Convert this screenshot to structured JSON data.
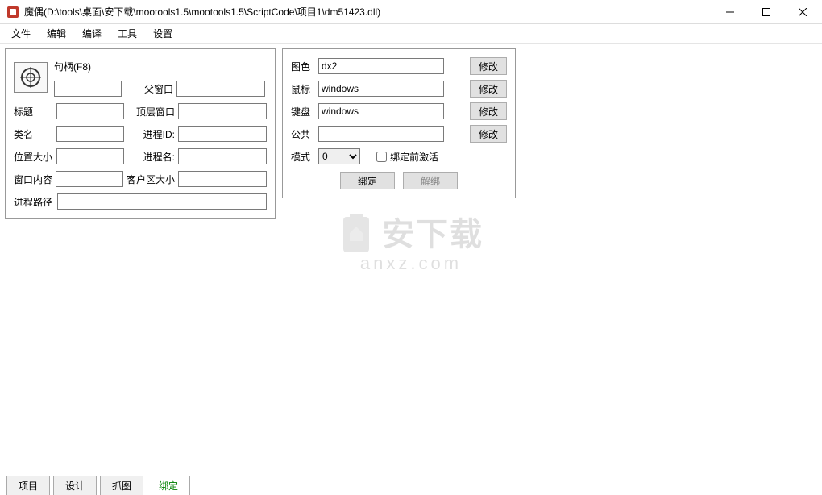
{
  "title": "魔偶(D:\\tools\\桌面\\安下载\\mootools1.5\\mootools1.5\\ScriptCode\\项目1\\dm51423.dll)",
  "menu": [
    "文件",
    "编辑",
    "编译",
    "工具",
    "设置"
  ],
  "left_panel": {
    "handle_label": "句柄(F8)",
    "handle_val": "",
    "parent_label": "父窗口",
    "parent_val": "",
    "title_label": "标题",
    "title_val": "",
    "top_label": "顶层窗口",
    "top_val": "",
    "class_label": "类名",
    "class_val": "",
    "pid_label": "进程ID:",
    "pid_val": "",
    "pos_label": "位置大小",
    "pos_val": "",
    "pname_label": "进程名:",
    "pname_val": "",
    "content_label": "窗口内容",
    "content_val": "",
    "client_label": "客户区大小",
    "client_val": "",
    "path_label": "进程路径",
    "path_val": ""
  },
  "right_panel": {
    "color_label": "图色",
    "color_val": "dx2",
    "mouse_label": "鼠标",
    "mouse_val": "windows",
    "keyboard_label": "键盘",
    "keyboard_val": "windows",
    "public_label": "公共",
    "public_val": "",
    "modify_btn": "修改",
    "mode_label": "模式",
    "mode_val": "0",
    "activate_label": "绑定前激活",
    "bind_btn": "绑定",
    "unbind_btn": "解绑"
  },
  "tabs": [
    {
      "label": "项目",
      "active": false
    },
    {
      "label": "设计",
      "active": false
    },
    {
      "label": "抓图",
      "active": false
    },
    {
      "label": "绑定",
      "active": true
    }
  ],
  "watermark": {
    "text": "安下载",
    "sub": "anxz.com"
  }
}
